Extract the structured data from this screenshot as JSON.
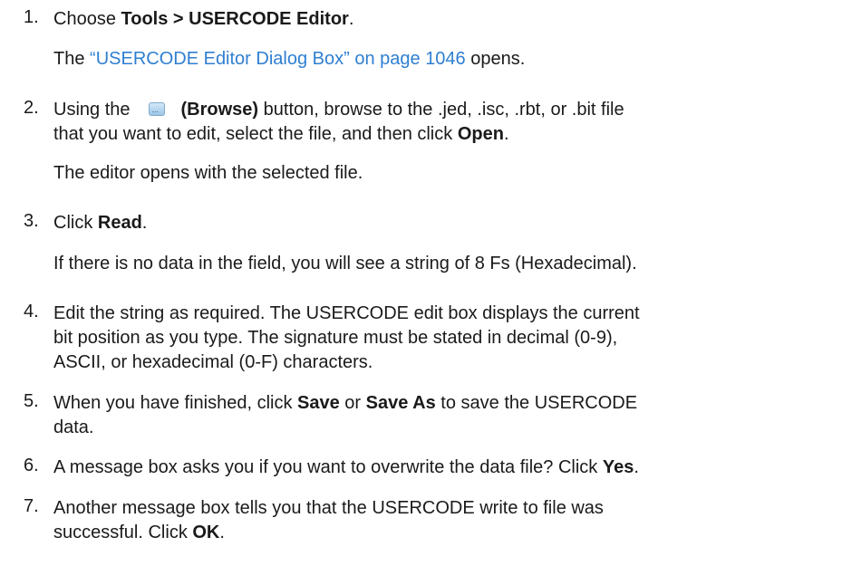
{
  "steps": [
    {
      "num": "1.",
      "pre": "Choose ",
      "bold": "Tools > USERCODE Editor",
      "post": "."
    },
    {
      "num": "2.",
      "pre": "Using the",
      "bold": "(Browse)",
      "post_line1": " button, browse to the .jed, .isc, .rbt, or .bit file",
      "line2_pre": "that you want to edit, select the file, and then click ",
      "line2_bold": "Open",
      "line2_post": "."
    },
    {
      "num": "3.",
      "pre": "Click ",
      "bold": "Read",
      "post": "."
    },
    {
      "num": "4.",
      "line1": "Edit the string as required. The USERCODE edit box displays the current",
      "line2": "bit position as you type. The signature must be stated in decimal (0-9),",
      "line3": "ASCII, or hexadecimal (0-F) characters."
    },
    {
      "num": "5.",
      "pre": "When you have finished, click ",
      "bold1": "Save",
      "mid": " or ",
      "bold2": "Save As",
      "post_line1": " to save the USERCODE",
      "line2": "data."
    },
    {
      "num": "6.",
      "pre": "A message box asks you if you want to overwrite the data file? Click ",
      "bold": "Yes",
      "post": "."
    },
    {
      "num": "7.",
      "line1": "Another message box tells you that the USERCODE write to file was",
      "line2_pre": "successful. Click ",
      "line2_bold": "OK",
      "line2_post": "."
    }
  ],
  "sub": {
    "step1_pre": "The ",
    "step1_link": "“USERCODE Editor Dialog Box” on page 1046",
    "step1_post": " opens.",
    "step2": "The editor opens with the selected file.",
    "step3": "If there is no data in the field, you will see a string of 8 Fs (Hexadecimal)."
  },
  "icons": {
    "browse": "browse-button-icon"
  },
  "colors": {
    "link": "#2f7fd1",
    "text": "#1a1a1a"
  }
}
